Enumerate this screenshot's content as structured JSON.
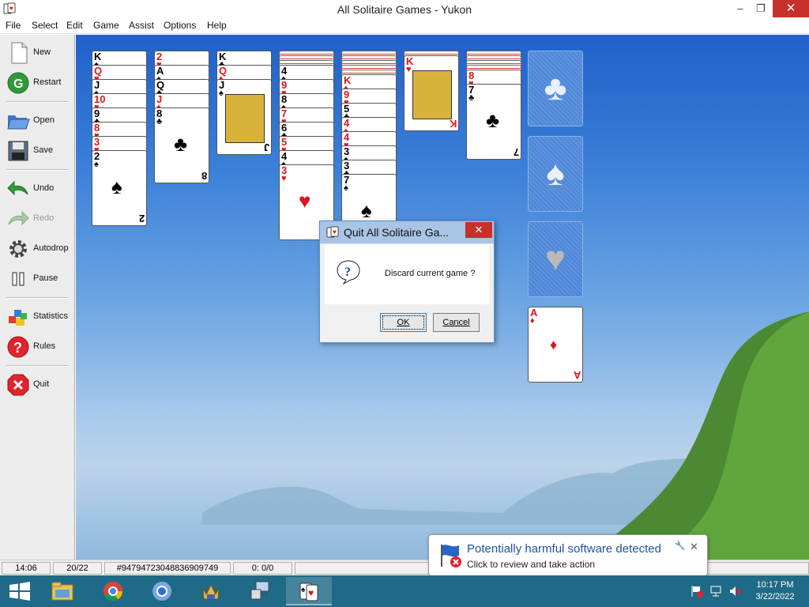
{
  "window": {
    "title": "All Solitaire Games - Yukon",
    "min_icon": "minimize-icon",
    "max_icon": "maximize-icon",
    "close_icon": "close-icon"
  },
  "menu": [
    "File",
    "Select",
    "Edit",
    "Game",
    "Assist",
    "Options",
    "Help"
  ],
  "toolbar": {
    "new": "New",
    "restart": "Restart",
    "open": "Open",
    "save": "Save",
    "undo": "Undo",
    "redo": "Redo",
    "autodrop": "Autodrop",
    "pause": "Pause",
    "statistics": "Statistics",
    "rules": "Rules",
    "quit": "Quit"
  },
  "tableau": [
    {
      "cards": [
        "K",
        "Q",
        "J",
        "10",
        "9",
        "8",
        "3",
        "2"
      ],
      "colors": [
        "black",
        "red",
        "black",
        "red",
        "black",
        "red",
        "red",
        "black"
      ],
      "suits": [
        "♠",
        "♥",
        "♠",
        "♥",
        "♣",
        "♥",
        "♥",
        "♠"
      ]
    },
    {
      "cards": [
        "2",
        "A",
        "Q",
        "J",
        "8"
      ],
      "colors": [
        "red",
        "black",
        "black",
        "red",
        "black"
      ],
      "suits": [
        "♥",
        "♠",
        "♣",
        "♦",
        "♣"
      ]
    },
    {
      "cards": [
        "K",
        "Q",
        "J"
      ],
      "colors": [
        "black",
        "red",
        "black"
      ],
      "suits": [
        "♣",
        "♦",
        "♠"
      ]
    },
    {
      "cards": [
        "4",
        "9",
        "8",
        "7",
        "6",
        "5",
        "4",
        "3"
      ],
      "colors": [
        "black",
        "red",
        "black",
        "red",
        "black",
        "red",
        "black",
        "red"
      ],
      "suits": [
        "♠",
        "♥",
        "♠",
        "♥",
        "♣",
        "♥",
        "♠",
        "♥"
      ]
    },
    {
      "cards": [
        "K",
        "9",
        "5",
        "4",
        "4",
        "3",
        "3",
        "7"
      ],
      "colors": [
        "red",
        "red",
        "black",
        "red",
        "red",
        "black",
        "black",
        "black"
      ],
      "suits": [
        "♦",
        "♥",
        "♣",
        "♦",
        "♥",
        "♠",
        "♣",
        "♠"
      ]
    },
    {
      "cards": [
        "K"
      ],
      "colors": [
        "red"
      ],
      "suits": [
        "♥"
      ]
    },
    {
      "cards": [
        "8",
        "7"
      ],
      "colors": [
        "red",
        "black"
      ],
      "suits": [
        "♥",
        "♣"
      ]
    }
  ],
  "foundations": [
    {
      "suit": "♣",
      "icon": "club-icon"
    },
    {
      "suit": "♠",
      "icon": "spade-icon"
    },
    {
      "suit": "♥",
      "icon": "heart-icon"
    },
    {
      "top_card": "A",
      "suit": "♦",
      "color": "red"
    }
  ],
  "dialog": {
    "title": "Quit All Solitaire Ga...",
    "message": "Discard current game ?",
    "ok": "OK",
    "cancel": "Cancel",
    "close": "✕"
  },
  "status": {
    "time": "14:06",
    "progress": "20/22",
    "seed": "#9479472304883690974\u00009",
    "score": "0: 0/0"
  },
  "notification": {
    "title": "Potentially harmful software detected",
    "body": "Click to review and take action"
  },
  "taskbar": {
    "time": "10:17 PM",
    "date": "3/22/2022"
  }
}
